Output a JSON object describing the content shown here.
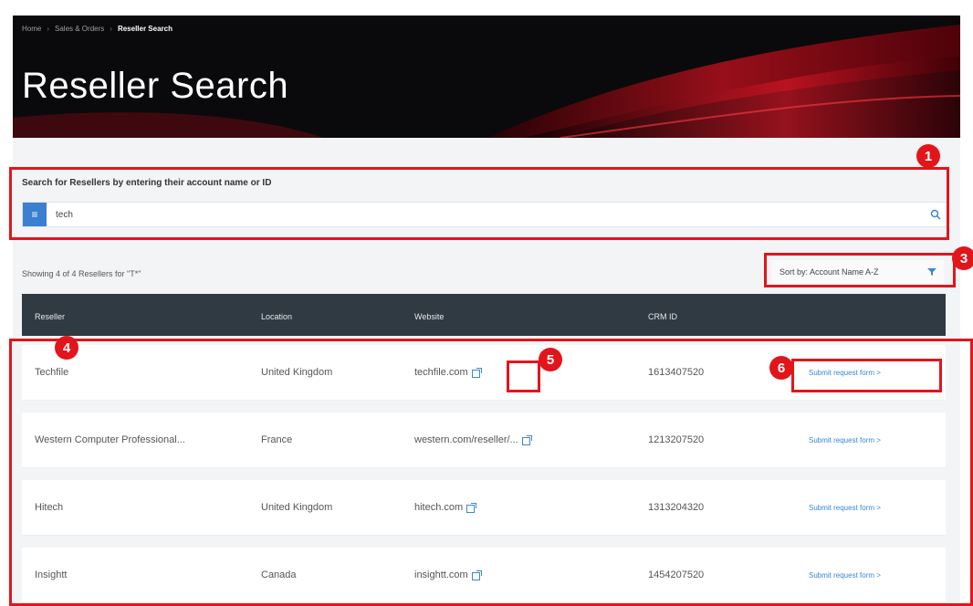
{
  "breadcrumb": [
    "Home",
    "Sales & Orders",
    "Reseller Search"
  ],
  "page_title": "Reseller Search",
  "search": {
    "label": "Search for Resellers by entering their account name or ID",
    "chip": "≡",
    "value": "tech"
  },
  "results_count": "Showing 4 of 4 Resellers for \"T*\"",
  "sort_label": "Sort by: Account Name A-Z",
  "table": {
    "columns": [
      "Reseller",
      "Location",
      "Website",
      "CRM ID"
    ],
    "rows": [
      {
        "name": "Techfile",
        "location": "United Kingdom",
        "website": "techfile.com",
        "crm": "1613407520",
        "cta": "Submit request form >"
      },
      {
        "name": "Western Computer Professional...",
        "location": "France",
        "website": "western.com/reseller/...",
        "crm": "1213207520",
        "cta": "Submit request form >"
      },
      {
        "name": "Hitech",
        "location": "United Kingdom",
        "website": "hitech.com",
        "crm": "1313204320",
        "cta": "Submit request form >"
      },
      {
        "name": "Insightt",
        "location": "Canada",
        "website": "insightt.com",
        "crm": "1454207520",
        "cta": "Submit request form >"
      }
    ]
  },
  "annotations": [
    "1",
    "3",
    "4",
    "5",
    "6"
  ],
  "colors": {
    "accent": "#e2151b",
    "header": "#2f3a43",
    "link": "#3a86d4",
    "chip": "#3a7fd0"
  }
}
